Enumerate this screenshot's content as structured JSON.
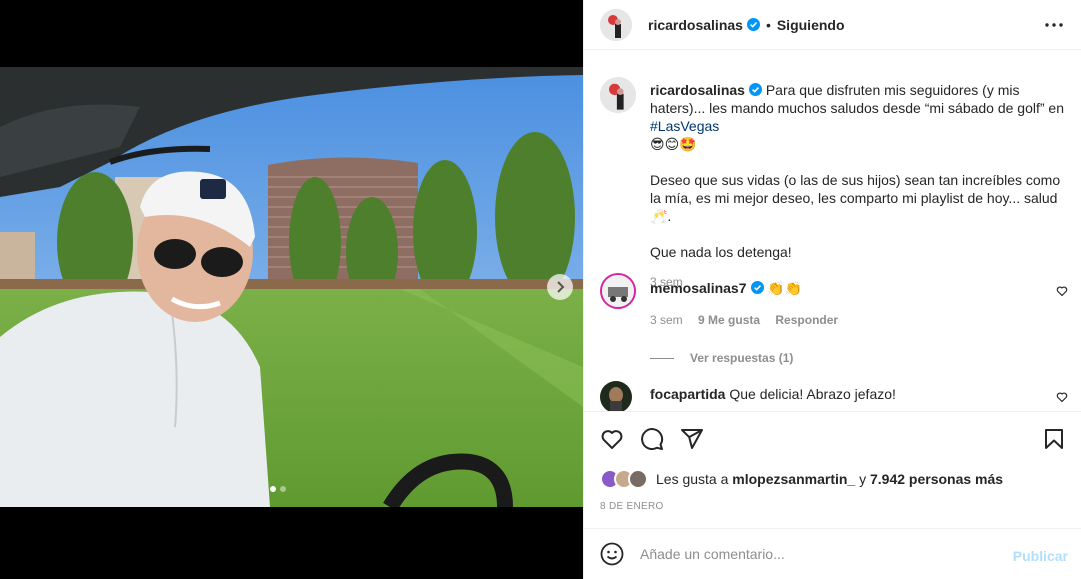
{
  "post": {
    "author": "ricardosalinas",
    "follow_sep": "•",
    "follow_status": "Siguiendo",
    "caption": {
      "username": "ricardosalinas",
      "line1": "Para que disfruten mis seguidores (y mis haters)... les mando muchos saludos desde “mi sábado de golf” en ",
      "hashtag": "#LasVegas",
      "emojis": "😎😊🤩",
      "para2": "Deseo que sus vidas (o las de sus hijos) sean tan increíbles como la mía, es mi mejor deseo, les comparto mi playlist de hoy... salud 🥂.",
      "para3": "Que nada los detenga!",
      "time": "3 sem"
    }
  },
  "comments": [
    {
      "username": "memosalinas7",
      "text": "👏👏",
      "time": "3 sem",
      "likes": "9 Me gusta",
      "reply": "Responder",
      "view_replies": "Ver respuestas (1)"
    },
    {
      "username": "focapartida",
      "text": "Que delicia! Abrazo jefazo!"
    }
  ],
  "likes": {
    "prefix": "Les gusta a",
    "user": "mlopezsanmartin_",
    "middle": "y",
    "count": "7.942 personas más"
  },
  "date": "8 de enero",
  "composer": {
    "placeholder": "Añade un comentario...",
    "publish": "Publicar"
  },
  "carousel": {
    "slides": 2,
    "active": 1
  },
  "colors": {
    "link": "#00376b",
    "verified": "#0095f6",
    "muted": "#8e8e8e",
    "publish_disabled": "#b2dffc"
  },
  "icons": [
    "more-icon",
    "verified-icon",
    "heart-icon",
    "comment-icon",
    "share-icon",
    "bookmark-icon",
    "emoji-icon",
    "chevron-right-icon"
  ]
}
